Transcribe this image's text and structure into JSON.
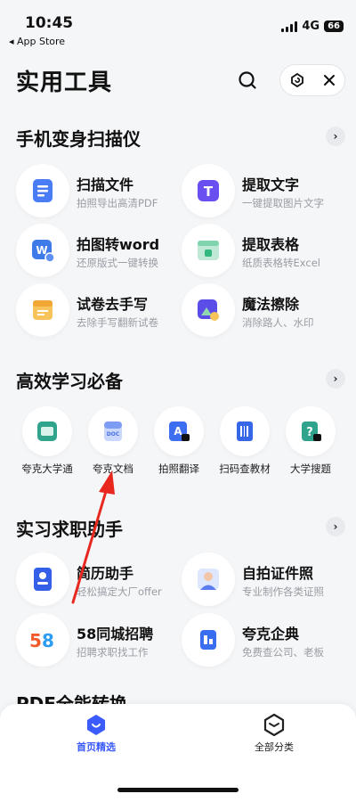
{
  "status_bar": {
    "time": "10:45",
    "back_label": "◂ App Store",
    "network": "4G",
    "battery": "66"
  },
  "header": {
    "title": "实用工具"
  },
  "sections": {
    "scanner": {
      "title": "手机变身扫描仪",
      "tools": [
        {
          "name": "扫描文件",
          "desc": "拍照导出高清PDF",
          "icon": "document-scan-icon"
        },
        {
          "name": "提取文字",
          "desc": "一键提取图片文字",
          "icon": "text-extract-icon"
        },
        {
          "name": "拍图转word",
          "desc": "还原版式一键转换",
          "icon": "word-icon"
        },
        {
          "name": "提取表格",
          "desc": "纸质表格转Excel",
          "icon": "table-extract-icon"
        },
        {
          "name": "试卷去手写",
          "desc": "去除手写翻新试卷",
          "icon": "exam-icon"
        },
        {
          "name": "魔法擦除",
          "desc": "消除路人、水印",
          "icon": "magic-eraser-icon"
        }
      ]
    },
    "study": {
      "title": "高效学习必备",
      "items": [
        {
          "label": "夸克大学通",
          "icon": "campus-app-icon"
        },
        {
          "label": "夸克文档",
          "icon": "docs-icon"
        },
        {
          "label": "拍照翻译",
          "icon": "photo-translate-icon"
        },
        {
          "label": "扫码查教材",
          "icon": "barcode-book-icon"
        },
        {
          "label": "大学搜题",
          "icon": "question-search-icon"
        }
      ]
    },
    "career": {
      "title": "实习求职助手",
      "tools": [
        {
          "name": "简历助手",
          "desc": "轻松搞定大厂offer",
          "icon": "resume-icon"
        },
        {
          "name": "自拍证件照",
          "desc": "专业制作各类证照",
          "icon": "id-photo-icon"
        },
        {
          "name": "58同城招聘",
          "desc": "招聘求职找工作",
          "icon": "58-logo-icon"
        },
        {
          "name": "夸克企典",
          "desc": "免费查公司、老板",
          "icon": "company-icon"
        }
      ]
    },
    "pdf": {
      "title": "PDF全能转换"
    }
  },
  "bottom_nav": [
    {
      "label": "首页精选",
      "active": true
    },
    {
      "label": "全部分类",
      "active": false
    }
  ],
  "colors": {
    "accent": "#3b5bfd",
    "annotation": "#e8281e",
    "background": "#f5f6f8"
  }
}
